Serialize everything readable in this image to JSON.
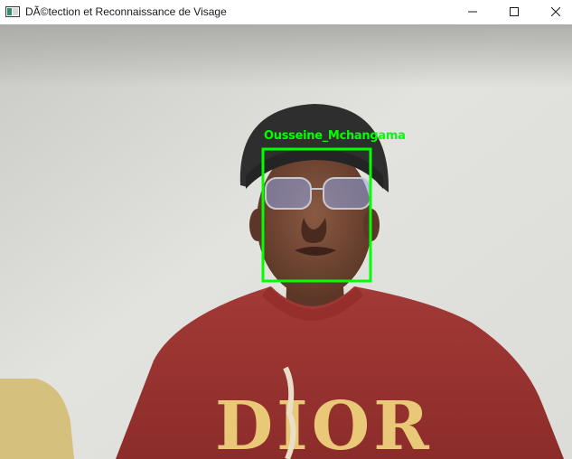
{
  "window": {
    "title": "DÃ©tection et Reconnaissance de Visage",
    "icons": {
      "app": "camera-app-icon",
      "minimize": "minimize-icon",
      "maximize": "maximize-icon",
      "close": "close-icon"
    }
  },
  "detection": {
    "label": "Ousseine_Mchangama",
    "box_color": "#00ff00"
  },
  "sweater_print": {
    "text": "DIOR"
  }
}
